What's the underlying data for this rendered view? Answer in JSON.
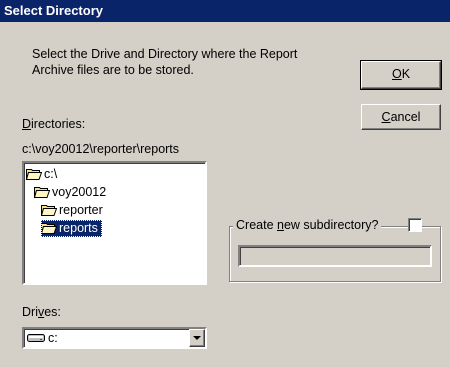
{
  "window": {
    "title": "Select Directory"
  },
  "instructions": {
    "line1": "Select the Drive and Directory where the Report",
    "line2": "Archive files are to be stored."
  },
  "buttons": {
    "ok_mnemonic": "O",
    "ok_rest": "K",
    "cancel_mnemonic": "C",
    "cancel_rest": "ancel"
  },
  "directories": {
    "label_mnemonic": "D",
    "label_rest": "irectories:",
    "current_path": "c:\\voy20012\\reporter\\reports",
    "items": [
      {
        "label": "c:\\",
        "icon": "open-folder-icon",
        "selected": false
      },
      {
        "label": "voy20012",
        "icon": "open-folder-icon",
        "selected": false
      },
      {
        "label": "reporter",
        "icon": "open-folder-icon",
        "selected": false
      },
      {
        "label": "reports",
        "icon": "open-folder-icon",
        "selected": true
      }
    ]
  },
  "new_subdirectory": {
    "label_pre": "Create ",
    "label_mnemonic": "n",
    "label_post": "ew subdirectory?",
    "checked": false,
    "value": ""
  },
  "drives": {
    "label_pre": "Dri",
    "label_mnemonic": "v",
    "label_post": "es:",
    "selected": "c:",
    "icon": "drive-icon"
  },
  "colors": {
    "face": "#d4d0c8",
    "titlebar": "#0a246a",
    "selection": "#0a246a",
    "folder": "#f7e08a"
  }
}
